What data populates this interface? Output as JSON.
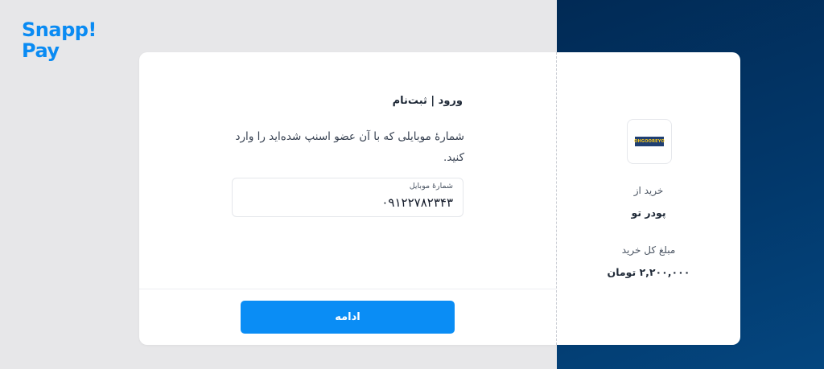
{
  "brand": {
    "logo_line1": "Snapp!",
    "logo_line2": "Pay",
    "accent_color": "#0a8bf3"
  },
  "form": {
    "title": "ورود | ثبت‌نام",
    "description": "شمارهٔ موبایلی که با آن عضو اسنپ شده‌اید را وارد کنید.",
    "phone_label": "شمارهٔ موبایل",
    "phone_value": "۰۹۱۲۲۷۸۲۳۴۳",
    "continue_label": "ادامه"
  },
  "purchase": {
    "merchant_logo_text": "OHGOOREYO",
    "buy_from_label": "خرید از",
    "merchant_name": "پودر تو",
    "total_label": "مبلغ کل خرید",
    "total_value": "۲,۲۰۰,۰۰۰ تومان"
  }
}
